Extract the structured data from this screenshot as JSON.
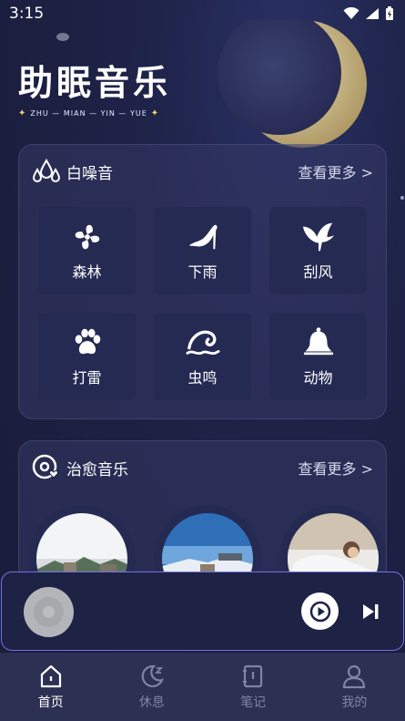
{
  "status": {
    "time": "3:15"
  },
  "hero": {
    "title": "助眠音乐",
    "subtitle": "ZHU — MIAN — YIN — YUE"
  },
  "white_noise": {
    "title": "白噪音",
    "more": "查看更多 >",
    "items": [
      {
        "label": "森林",
        "icon": "fan-icon"
      },
      {
        "label": "下雨",
        "icon": "high-heel-icon"
      },
      {
        "label": "刮风",
        "icon": "bird-icon"
      },
      {
        "label": "打雷",
        "icon": "paw-icon"
      },
      {
        "label": "虫鸣",
        "icon": "wave-icon"
      },
      {
        "label": "动物",
        "icon": "bell-icon"
      }
    ]
  },
  "healing_music": {
    "title": "治愈音乐",
    "more": "查看更多 >"
  },
  "tabs": [
    {
      "label": "首页",
      "icon": "home-icon",
      "active": true
    },
    {
      "label": "休息",
      "icon": "moon-icon",
      "active": false
    },
    {
      "label": "笔记",
      "icon": "notebook-icon",
      "active": false
    },
    {
      "label": "我的",
      "icon": "user-icon",
      "active": false
    }
  ],
  "colors": {
    "accent": "#6f74e6",
    "tile": "#252a52",
    "moon": "#cbb98a"
  }
}
